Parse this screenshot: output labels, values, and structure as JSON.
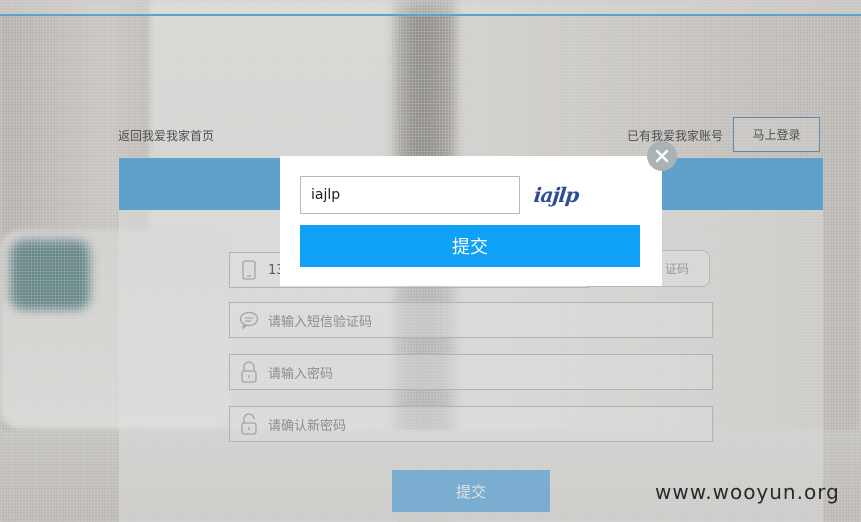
{
  "header": {
    "back_home_link": "返回我爱我家首页",
    "has_account_text": "已有我爱我家账号",
    "login_button": "马上登录"
  },
  "form": {
    "phone_value": "13",
    "get_code_button": "证码",
    "sms_code_placeholder": "请输入短信验证码",
    "password_placeholder": "请输入密码",
    "confirm_password_placeholder": "请确认新密码",
    "submit_button": "提交"
  },
  "captcha_dialog": {
    "input_value": "iajlp",
    "captcha_image_text": "iajlp",
    "submit_button": "提交",
    "close_icon": "close-icon"
  },
  "watermark": "www.wooyun.org",
  "colors": {
    "accent": "#4aa6e0",
    "modal_button": "#0ea1f5",
    "top_border": "#4ba3dc"
  }
}
